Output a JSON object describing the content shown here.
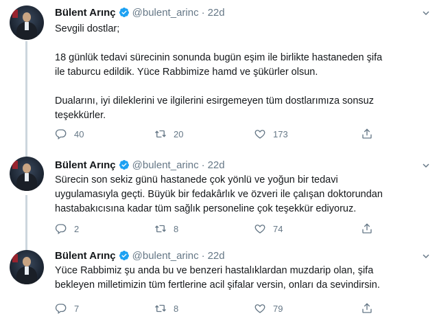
{
  "tweets": [
    {
      "name": "Bülent Arınç",
      "handle": "@bulent_arinc",
      "time": "22d",
      "paragraphs": [
        [
          "Sevgili dostlar;"
        ],
        [
          "18 günlük tedavi sürecinin sonunda bugün eşim ile birlikte hastaneden şifa",
          "ile taburcu edildik. Yüce Rabbimize hamd ve şükürler olsun."
        ],
        [
          "Dualarını, iyi dileklerini ve ilgilerini esirgemeyen tüm dostlarımıza sonsuz",
          "teşekkürler."
        ]
      ],
      "replies": "40",
      "retweets": "20",
      "likes": "173"
    },
    {
      "name": "Bülent Arınç",
      "handle": "@bulent_arinc",
      "time": "22d",
      "paragraphs": [
        [
          "Sürecin son sekiz günü hastanede çok yönlü ve yoğun bir tedavi",
          "uygulamasıyla geçti. Büyük bir fedakârlık ve özveri ile çalışan doktorundan",
          "hastabakıcısına kadar tüm sağlık personeline çok teşekkür ediyoruz."
        ]
      ],
      "replies": "2",
      "retweets": "8",
      "likes": "74"
    },
    {
      "name": "Bülent Arınç",
      "handle": "@bulent_arinc",
      "time": "22d",
      "paragraphs": [
        [
          "Yüce Rabbimiz şu anda bu ve benzeri hastalıklardan muzdarip olan, şifa",
          "bekleyen milletimizin tüm fertlerine acil şifalar versin, onları da sevindirsin."
        ]
      ],
      "replies": "7",
      "retweets": "8",
      "likes": "79"
    }
  ],
  "icons": {
    "verified": "verified-badge-icon",
    "caret": "chevron-down-icon",
    "reply": "reply-icon",
    "retweet": "retweet-icon",
    "like": "heart-icon",
    "share": "share-icon"
  },
  "colors": {
    "verified": "#1da1f2",
    "muted": "#657786",
    "text": "#14171a",
    "thread_line": "#ccd6dd"
  }
}
